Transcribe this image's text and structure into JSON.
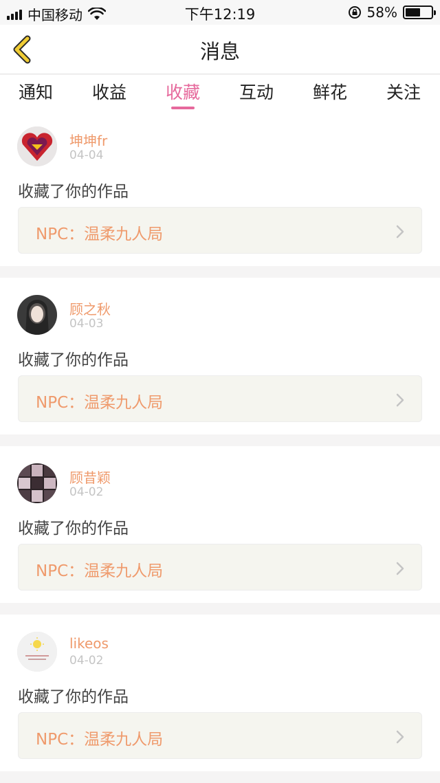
{
  "status_bar": {
    "carrier": "中国移动",
    "time": "下午12:19",
    "battery": "58%",
    "battery_level": 0.58
  },
  "nav": {
    "title": "消息"
  },
  "tabs": [
    {
      "label": "通知"
    },
    {
      "label": "收益"
    },
    {
      "label": "收藏",
      "active": true
    },
    {
      "label": "互动"
    },
    {
      "label": "鲜花"
    },
    {
      "label": "关注"
    }
  ],
  "feed": [
    {
      "username": "坤坤fr",
      "date": "04-04",
      "action": "收藏了你的作品",
      "work": "NPC：温柔九人局"
    },
    {
      "username": "顾之秋",
      "date": "04-03",
      "action": "收藏了你的作品",
      "work": "NPC：温柔九人局"
    },
    {
      "username": "顾昔颖",
      "date": "04-02",
      "action": "收藏了你的作品",
      "work": "NPC：温柔九人局"
    },
    {
      "username": "likeos",
      "date": "04-02",
      "action": "收藏了你的作品",
      "work": "NPC：温柔九人局"
    }
  ],
  "colors": {
    "accent": "#e6699c",
    "username": "#ef9a6c",
    "back_icon": "#f0cc34"
  }
}
